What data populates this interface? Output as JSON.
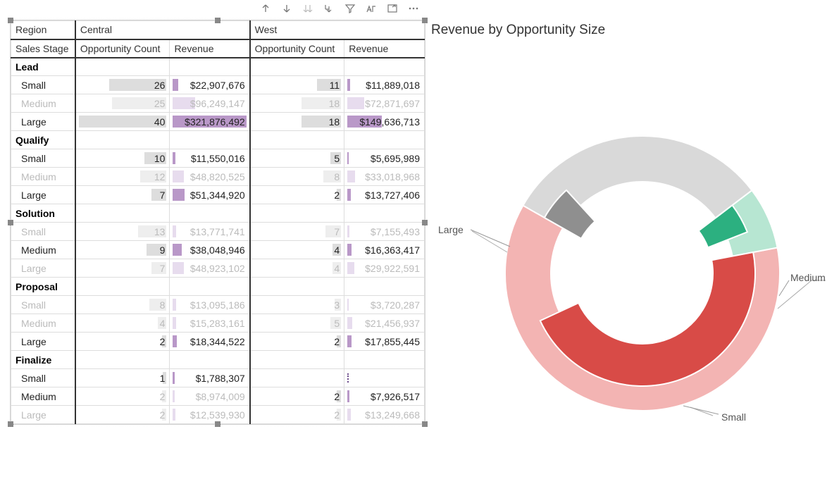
{
  "toolbar": {
    "items": [
      "drill-up",
      "drill-down",
      "expand-all",
      "goto-level",
      "filter",
      "spotlight",
      "export",
      "more"
    ]
  },
  "matrix": {
    "corner_region": "Region",
    "corner_stage": "Sales Stage",
    "regions": [
      "Central",
      "West"
    ],
    "measures": [
      "Opportunity Count",
      "Revenue"
    ],
    "max_opp": 40,
    "max_rev": 321876492,
    "groups": [
      {
        "name": "Lead",
        "rows": [
          {
            "size": "Small",
            "highlight": true,
            "c_opp": 26,
            "c_rev": "$22,907,676",
            "c_rev_n": 22907676,
            "w_opp": 11,
            "w_rev": "$11,889,018",
            "w_rev_n": 11889018
          },
          {
            "size": "Medium",
            "highlight": false,
            "c_opp": 25,
            "c_rev": "$96,249,147",
            "c_rev_n": 96249147,
            "w_opp": 18,
            "w_rev": "$72,871,697",
            "w_rev_n": 72871697
          },
          {
            "size": "Large",
            "highlight": true,
            "c_opp": 40,
            "c_rev": "$321,876,492",
            "c_rev_n": 321876492,
            "w_opp": 18,
            "w_rev": "$149,636,713",
            "w_rev_n": 149636713
          }
        ]
      },
      {
        "name": "Qualify",
        "rows": [
          {
            "size": "Small",
            "highlight": true,
            "c_opp": 10,
            "c_rev": "$11,550,016",
            "c_rev_n": 11550016,
            "w_opp": 5,
            "w_rev": "$5,695,989",
            "w_rev_n": 5695989
          },
          {
            "size": "Medium",
            "highlight": false,
            "c_opp": 12,
            "c_rev": "$48,820,525",
            "c_rev_n": 48820525,
            "w_opp": 8,
            "w_rev": "$33,018,968",
            "w_rev_n": 33018968
          },
          {
            "size": "Large",
            "highlight": true,
            "c_opp": 7,
            "c_rev": "$51,344,920",
            "c_rev_n": 51344920,
            "w_opp": 2,
            "w_rev": "$13,727,406",
            "w_rev_n": 13727406
          }
        ]
      },
      {
        "name": "Solution",
        "rows": [
          {
            "size": "Small",
            "highlight": false,
            "c_opp": 13,
            "c_rev": "$13,771,741",
            "c_rev_n": 13771741,
            "w_opp": 7,
            "w_rev": "$7,155,493",
            "w_rev_n": 7155493
          },
          {
            "size": "Medium",
            "highlight": true,
            "c_opp": 9,
            "c_rev": "$38,048,946",
            "c_rev_n": 38048946,
            "w_opp": 4,
            "w_rev": "$16,363,417",
            "w_rev_n": 16363417
          },
          {
            "size": "Large",
            "highlight": false,
            "c_opp": 7,
            "c_rev": "$48,923,102",
            "c_rev_n": 48923102,
            "w_opp": 4,
            "w_rev": "$29,922,591",
            "w_rev_n": 29922591
          }
        ]
      },
      {
        "name": "Proposal",
        "rows": [
          {
            "size": "Small",
            "highlight": false,
            "c_opp": 8,
            "c_rev": "$13,095,186",
            "c_rev_n": 13095186,
            "w_opp": 3,
            "w_rev": "$3,720,287",
            "w_rev_n": 3720287
          },
          {
            "size": "Medium",
            "highlight": false,
            "c_opp": 4,
            "c_rev": "$15,283,161",
            "c_rev_n": 15283161,
            "w_opp": 5,
            "w_rev": "$21,456,937",
            "w_rev_n": 21456937
          },
          {
            "size": "Large",
            "highlight": true,
            "c_opp": 2,
            "c_rev": "$18,344,522",
            "c_rev_n": 18344522,
            "w_opp": 2,
            "w_rev": "$17,855,445",
            "w_rev_n": 17855445
          }
        ]
      },
      {
        "name": "Finalize",
        "rows": [
          {
            "size": "Small",
            "highlight": true,
            "c_opp": 1,
            "c_rev": "$1,788,307",
            "c_rev_n": 1788307,
            "w_opp": null,
            "w_rev": "",
            "w_rev_n": 0
          },
          {
            "size": "Medium",
            "highlight": true,
            "c_opp": 2,
            "c_rev": "$8,974,009",
            "c_rev_n": 8974009,
            "c_faded": true,
            "w_opp": 2,
            "w_rev": "$7,926,517",
            "w_rev_n": 7926517
          },
          {
            "size": "Large",
            "highlight": false,
            "c_opp": 2,
            "c_rev": "$12,539,930",
            "c_rev_n": 12539930,
            "w_opp": 2,
            "w_rev": "$13,249,668",
            "w_rev_n": 13249668
          }
        ]
      }
    ]
  },
  "chart": {
    "title": "Revenue by Opportunity Size",
    "labels": {
      "large": "Large",
      "medium": "Medium",
      "small": "Small"
    }
  },
  "chart_data": {
    "type": "pie",
    "title": "Revenue by Opportunity Size",
    "rings": [
      {
        "name": "Total",
        "series": [
          {
            "name": "Large",
            "value": 761000000,
            "color": "#f3b4b3"
          },
          {
            "name": "Medium",
            "value": 391000000,
            "color": "#d9d9d9"
          },
          {
            "name": "Small",
            "value": 91000000,
            "color": "#b7e6d2"
          }
        ]
      },
      {
        "name": "Highlighted",
        "series": [
          {
            "name": "Large",
            "value": 573000000,
            "color": "#d84b47"
          },
          {
            "name": "Medium",
            "value": 62000000,
            "color": "#8f8f8f"
          },
          {
            "name": "Small",
            "value": 54000000,
            "color": "#2cb080"
          }
        ]
      }
    ]
  }
}
